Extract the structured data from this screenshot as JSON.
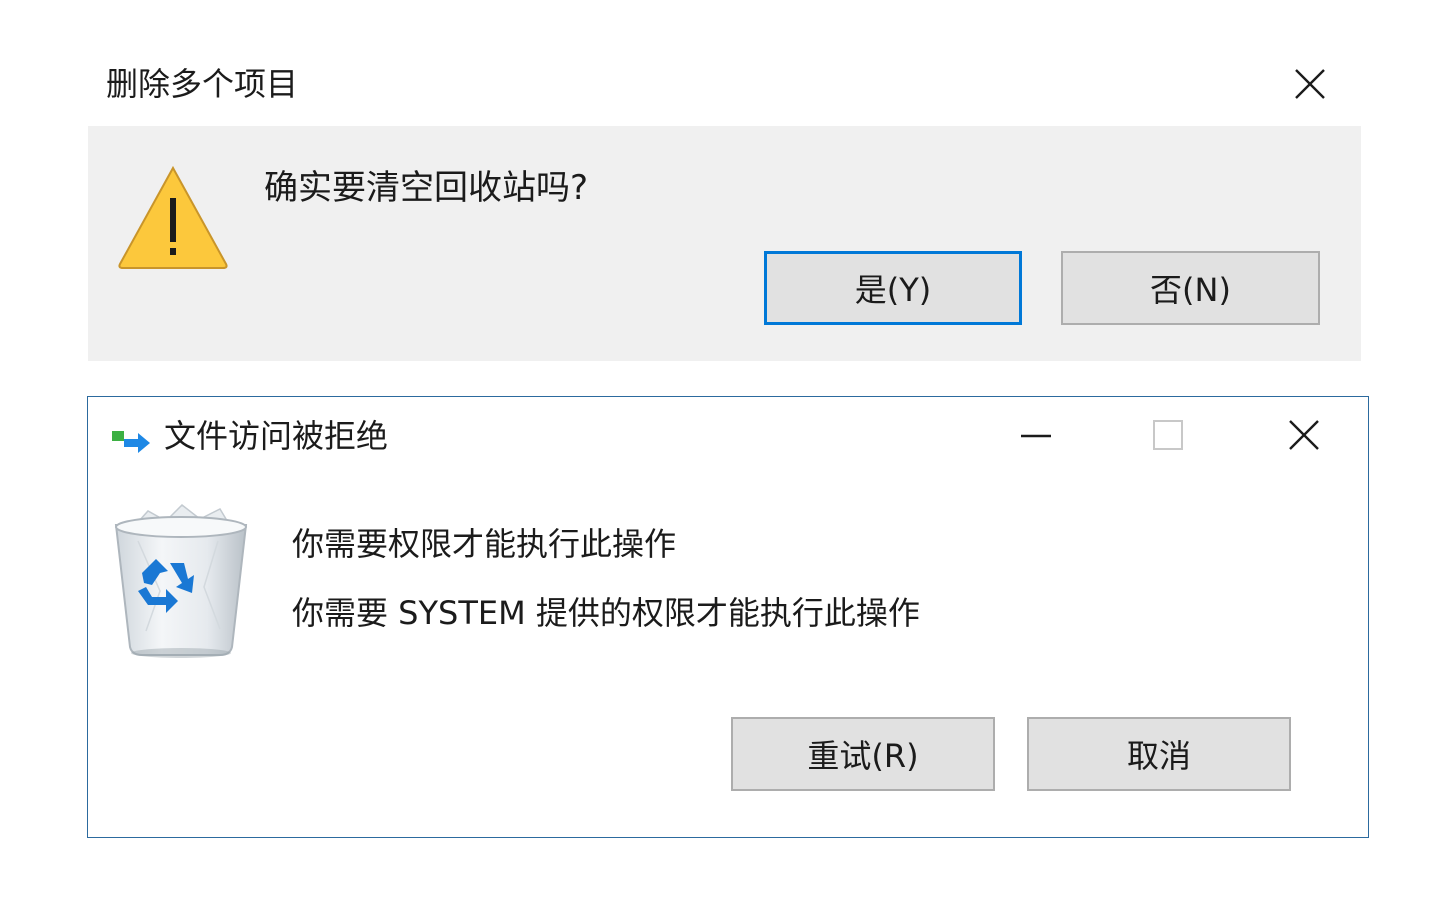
{
  "delete_dialog": {
    "title": "删除多个项目",
    "message": "确实要清空回收站吗?",
    "icons": {
      "warning": "warning-icon",
      "close": "close-icon"
    },
    "buttons": {
      "yes": "是(Y)",
      "no": "否(N)"
    },
    "colors": {
      "body": "#f0f0f0",
      "default_border": "#0078d7",
      "warning_fill": "#fcc83c"
    }
  },
  "access_dialog": {
    "title": "文件访问被拒绝",
    "line1": "你需要权限才能执行此操作",
    "line2": "你需要 SYSTEM 提供的权限才能执行此操作",
    "icons": {
      "app": "file-move-icon",
      "minimize": "minimize-icon",
      "maximize": "maximize-icon",
      "close": "close-icon",
      "recycle_bin": "recycle-bin-icon"
    },
    "buttons": {
      "retry": "重试(R)",
      "cancel": "取消"
    },
    "colors": {
      "border": "#2c6a9e",
      "button_bg": "#e1e1e1"
    }
  }
}
